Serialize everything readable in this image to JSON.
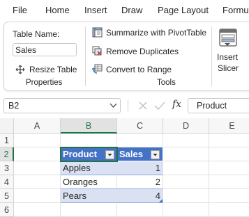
{
  "menu": {
    "file": "File",
    "home": "Home",
    "insert": "Insert",
    "draw": "Draw",
    "page_layout": "Page Layout",
    "formulas": "Formu"
  },
  "ribbon": {
    "table_name_label": "Table Name:",
    "table_name_value": "Sales",
    "resize_table": "Resize Table",
    "properties_group": "Properties",
    "summarize": "Summarize with PivotTable",
    "remove_duplicates": "Remove Duplicates",
    "convert_to_range": "Convert to Range",
    "tools_group": "Tools",
    "insert_slicer_line1": "Insert",
    "insert_slicer_line2": "Slicer"
  },
  "formula_bar": {
    "name_box": "B2",
    "fx": "fx",
    "content": "Product"
  },
  "grid": {
    "columns": [
      "A",
      "B",
      "C",
      "D",
      "E"
    ],
    "rows": [
      "1",
      "2",
      "3",
      "4",
      "5",
      "6"
    ],
    "table": {
      "headers": [
        "Product",
        "Sales"
      ],
      "rows": [
        {
          "product": "Apples",
          "sales": "1"
        },
        {
          "product": "Oranges",
          "sales": "2"
        },
        {
          "product": "Pears",
          "sales": "4"
        }
      ]
    }
  },
  "colors": {
    "accent": "#217346",
    "table_header": "#4472c4",
    "table_band": "#d9e1f2"
  }
}
